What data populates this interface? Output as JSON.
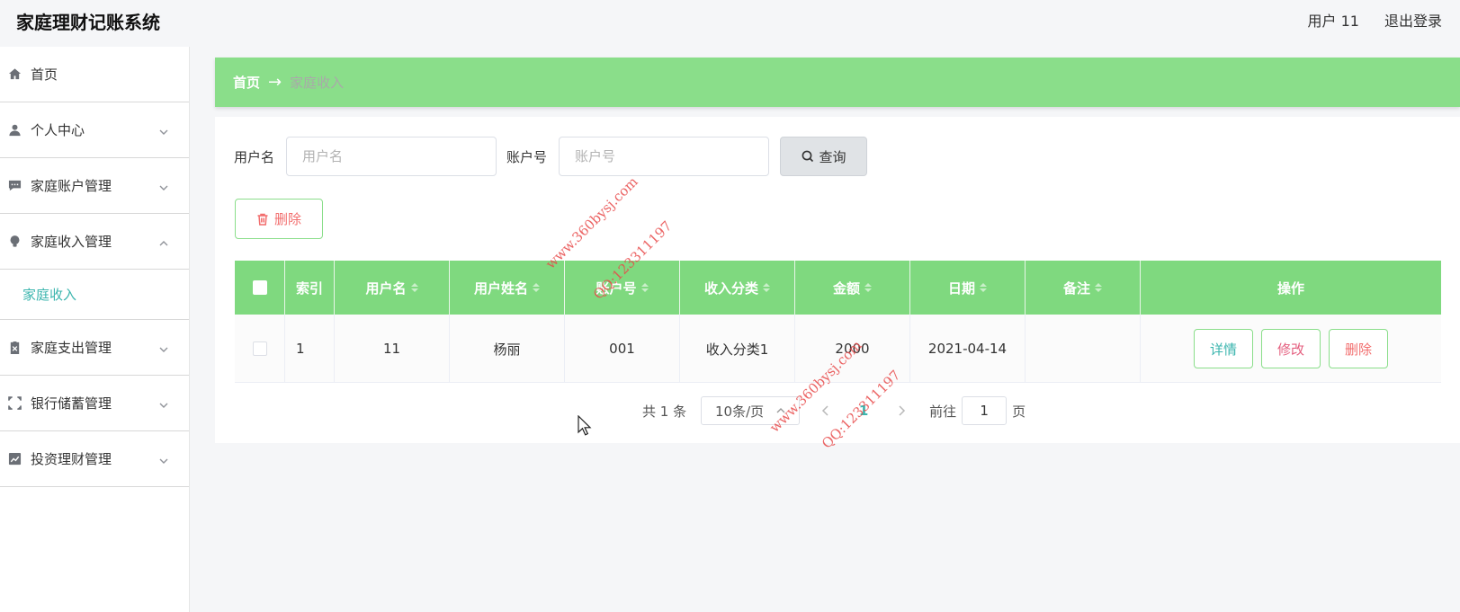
{
  "header": {
    "app_title": "家庭理财记账系统",
    "user_label": "用户 11",
    "logout_label": "退出登录"
  },
  "sidebar": {
    "items": [
      {
        "label": "首页",
        "icon": "home-icon"
      },
      {
        "label": "个人中心",
        "icon": "user-icon"
      },
      {
        "label": "家庭账户管理",
        "icon": "message-icon"
      },
      {
        "label": "家庭收入管理",
        "icon": "bulb-icon",
        "expanded": true
      },
      {
        "label": "家庭支出管理",
        "icon": "clipboard-icon"
      },
      {
        "label": "银行储蓄管理",
        "icon": "fullscreen-icon"
      },
      {
        "label": "投资理财管理",
        "icon": "chart-icon"
      }
    ],
    "submenu_active": "家庭收入"
  },
  "breadcrumb": {
    "home": "首页",
    "separator": "→",
    "current": "家庭收入"
  },
  "search": {
    "username_label": "用户名",
    "username_placeholder": "用户名",
    "username_value": "",
    "account_label": "账户号",
    "account_placeholder": "账户号",
    "account_value": "",
    "query_button": "查询"
  },
  "toolbar": {
    "delete_button": "删除"
  },
  "table": {
    "columns": [
      "索引",
      "用户名",
      "用户姓名",
      "账户号",
      "收入分类",
      "金额",
      "日期",
      "备注",
      "操作"
    ],
    "rows": [
      {
        "index": "1",
        "username": "11",
        "fullname": "杨丽",
        "account": "001",
        "category": "收入分类1",
        "amount": "2000",
        "date": "2021-04-14",
        "note": ""
      }
    ],
    "actions": {
      "detail": "详情",
      "edit": "修改",
      "delete": "删除"
    }
  },
  "pagination": {
    "total_label": "共 1 条",
    "page_size": "10条/页",
    "current_page": "1",
    "goto_label": "前往",
    "goto_value": "1",
    "page_unit": "页"
  },
  "watermark": {
    "site": "www.360bysj.com",
    "qq": "QQ:123311197"
  },
  "colors": {
    "accent_green": "#8ade8a",
    "header_green": "#7fd97f",
    "teal": "#3bb5ae",
    "danger": "#f26d6d"
  }
}
